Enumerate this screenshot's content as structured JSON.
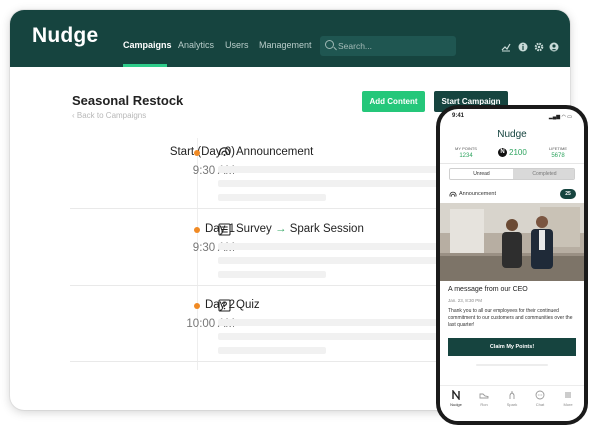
{
  "app": {
    "logo": "Nudge",
    "nav": [
      "Campaigns",
      "Analytics",
      "Users",
      "Management"
    ],
    "search_placeholder": "Search..."
  },
  "campaign": {
    "title": "Seasonal Restock",
    "back_link": "Back to Campaigns",
    "add_content_label": "Add Content",
    "start_campaign_label": "Start Campaign",
    "steps": [
      {
        "day": "Start (Day 0)",
        "time": "9:30 AM",
        "title": "Announcement",
        "icon": "announcement-icon"
      },
      {
        "day": "Day 1",
        "time": "9:30 AM",
        "title_a": "Survey",
        "arrow": "→",
        "title_b": "Spark Session",
        "icon": "survey-icon"
      },
      {
        "day": "Day 2",
        "time": "10:00 AM",
        "title": "Quiz",
        "icon": "quiz-icon"
      }
    ]
  },
  "colors": {
    "nav_bg": "#16443f",
    "accent_green": "#25c77a",
    "timeline_dot": "#f08a24",
    "points_green": "#2ea45f"
  },
  "phone": {
    "time": "9:41",
    "brand": "Nudge",
    "my_points_label": "MY POINTS",
    "my_points_value": "1234",
    "n_badge": "N",
    "center_points": "2100",
    "lifetime_label": "LIFETIME",
    "lifetime_value": "5678",
    "tabs": [
      "Unread",
      "Completed"
    ],
    "card_type": "Announcement",
    "card_points": "25",
    "message_title": "A message from our CEO",
    "message_date": "Jan. 23, 8:30 PM",
    "message_body": "Thank you to all our employees for their continued commitment to our customers and communities over the last quarter!",
    "cta": "Claim My Points!",
    "bottom_nav": [
      "Nudge",
      "Ron",
      "Spark",
      "Chat",
      "More"
    ]
  }
}
